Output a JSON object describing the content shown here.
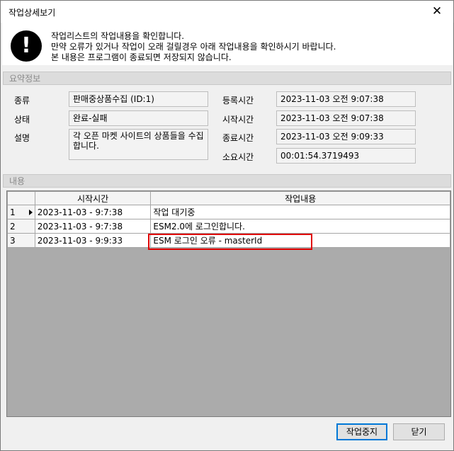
{
  "window": {
    "title": "작업상세보기",
    "close_glyph": "✕"
  },
  "banner": {
    "icon": "exclamation-icon",
    "line1": "작업리스트의 작업내용을 확인합니다.",
    "line2": "만약 오류가 있거나 작업이 오래 걸릴경우 아래 작업내용을 확인하시기 바랍니다.",
    "line3": "본 내용은 프로그램이 종료되면 저장되지 않습니다."
  },
  "summary": {
    "header": "요약정보",
    "type_label": "종류",
    "type_value": "판매중상품수집 (ID:1)",
    "status_label": "상태",
    "status_value": "완료-실패",
    "desc_label": "설명",
    "desc_value": "각 오픈 마켓 사이트의 상품들을 수집합니다.",
    "reg_label": "등록시간",
    "reg_value": "2023-11-03 오전 9:07:38",
    "start_label": "시작시간",
    "start_value": "2023-11-03 오전 9:07:38",
    "end_label": "종료시간",
    "end_value": "2023-11-03 오전 9:09:33",
    "elapsed_label": "소요시간",
    "elapsed_value": "00:01:54.3719493"
  },
  "content": {
    "header": "내용",
    "columns": [
      "시작시간",
      "작업내용"
    ],
    "rows": [
      {
        "no": "1",
        "time": "2023-11-03  -  9:7:38",
        "text": "작업 대기중"
      },
      {
        "no": "2",
        "time": "2023-11-03  -  9:7:38",
        "text": "ESM2.0에 로그인합니다."
      },
      {
        "no": "3",
        "time": "2023-11-03  -  9:9:33",
        "text": "ESM 로그인  오류  - masterId"
      }
    ]
  },
  "buttons": {
    "stop": "작업중지",
    "close": "닫기"
  },
  "colors": {
    "highlight": "#e00000",
    "default_button_border": "#0078d7"
  }
}
